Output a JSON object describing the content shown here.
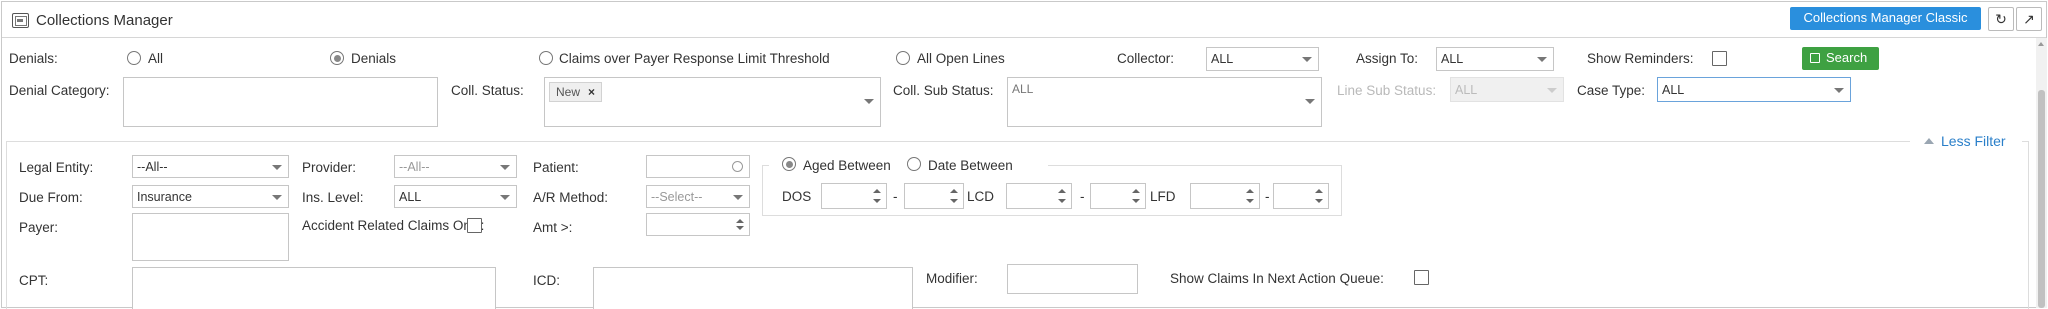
{
  "header": {
    "title": "Collections Manager",
    "classic_button": "Collections Manager Classic",
    "refresh_icon": "↻",
    "popout_icon": "↗"
  },
  "row1": {
    "denials_label": "Denials:",
    "radio_all": "All",
    "radio_denials": "Denials",
    "radio_claims_over": "Claims over Payer Response Limit Threshold",
    "radio_open_lines": "All Open Lines",
    "selected_radio": "Denials",
    "collector_label": "Collector:",
    "collector_value": "ALL",
    "assign_to_label": "Assign To:",
    "assign_to_value": "ALL",
    "show_reminders_label": "Show Reminders:",
    "search_button": "Search"
  },
  "row2": {
    "denial_category_label": "Denial Category:",
    "coll_status_label": "Coll. Status:",
    "coll_status_tag": "New",
    "coll_status_tag_remove": "×",
    "coll_sub_status_label": "Coll. Sub Status:",
    "coll_sub_status_value": "ALL",
    "line_sub_status_label": "Line Sub Status:",
    "line_sub_status_value": "ALL",
    "case_type_label": "Case Type:",
    "case_type_value": "ALL"
  },
  "filter_panel": {
    "less_filter": "Less Filter",
    "legal_entity_label": "Legal Entity:",
    "legal_entity_value": "--All--",
    "due_from_label": "Due From:",
    "due_from_value": "Insurance",
    "payer_label": "Payer:",
    "provider_label": "Provider:",
    "provider_value": "--All--",
    "ins_level_label": "Ins. Level:",
    "ins_level_value": "ALL",
    "accident_label": "Accident Related Claims Only:",
    "patient_label": "Patient:",
    "ar_method_label": "A/R Method:",
    "ar_method_value": "--Select--",
    "amt_label": "Amt >:",
    "aged_between": "Aged Between",
    "date_between": "Date Between",
    "selected_age_mode": "Aged Between",
    "dos_label": "DOS",
    "lcd_label": "LCD",
    "lfd_label": "LFD",
    "dash": "-",
    "cpt_label": "CPT:",
    "icd_label": "ICD:",
    "modifier_label": "Modifier:",
    "next_action_label": "Show Claims In Next Action Queue:"
  }
}
